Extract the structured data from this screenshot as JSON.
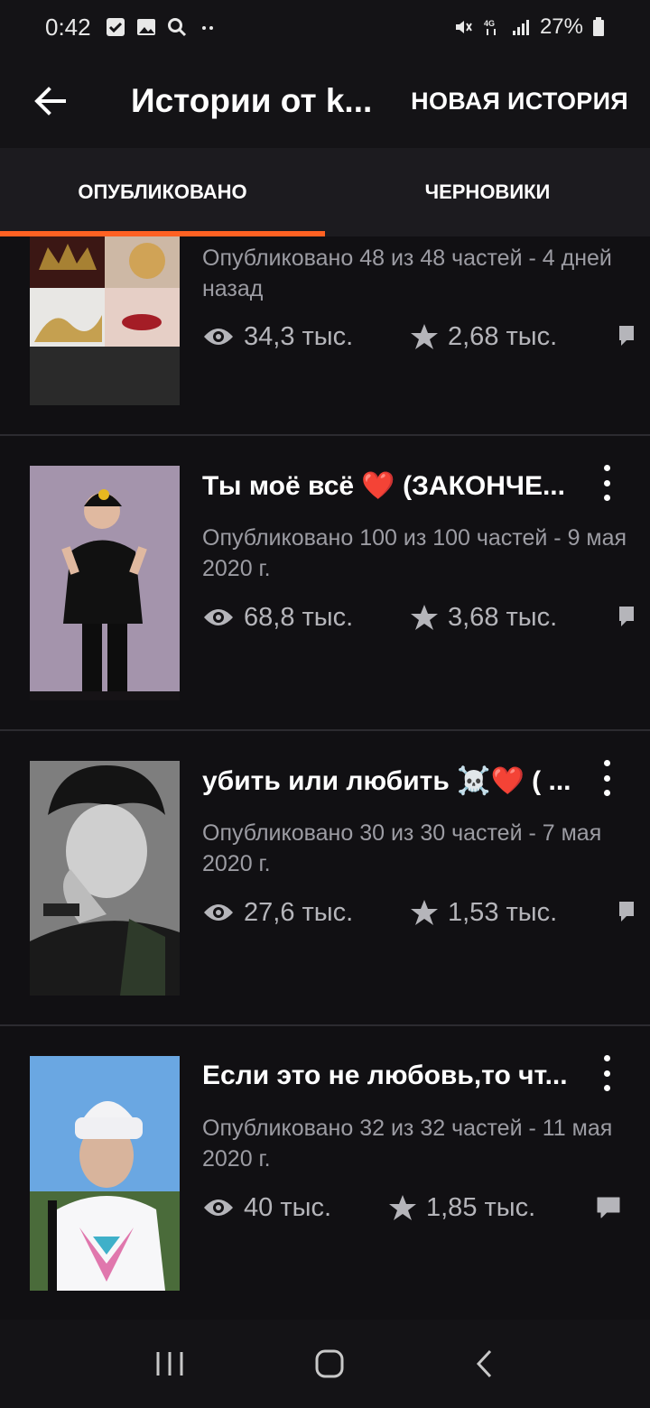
{
  "status": {
    "time": "0:42",
    "battery": "27%",
    "net": "4G"
  },
  "header": {
    "title": "Истории от k...",
    "new_story_label": "НОВАЯ ИСТОРИЯ"
  },
  "tabs": [
    {
      "label": "ОПУБЛИКОВАНО",
      "active": true
    },
    {
      "label": "ЧЕРНОВИКИ",
      "active": false
    }
  ],
  "stories": [
    {
      "title": "",
      "meta": "Опубликовано 48 из 48 частей - 4 дней назад",
      "views": "34,3 тыс.",
      "votes": "2,68 тыс.",
      "comments_icon": "comment-icon"
    },
    {
      "title": "Ты моё всё ❤️ (ЗАКОНЧЕ...",
      "meta": "Опубликовано 100 из 100 частей - 9 мая 2020 г.",
      "views": "68,8 тыс.",
      "votes": "3,68 тыс.",
      "comments_icon": "comment-icon"
    },
    {
      "title": "убить или любить ☠️❤️ ( ...",
      "meta": "Опубликовано 30 из 30 частей - 7 мая 2020 г.",
      "views": "27,6 тыс.",
      "votes": "1,53 тыс.",
      "comments_icon": "comment-icon"
    },
    {
      "title": "Если это не любовь,то чт...",
      "meta": "Опубликовано 32 из 32 частей - 11 мая 2020 г.",
      "views": "40 тыс.",
      "votes": "1,85 тыс.",
      "comments_icon": "comment-icon"
    }
  ],
  "colors": {
    "accent": "#ff6122",
    "background": "#111013",
    "meta_text": "#9c9ca3"
  }
}
